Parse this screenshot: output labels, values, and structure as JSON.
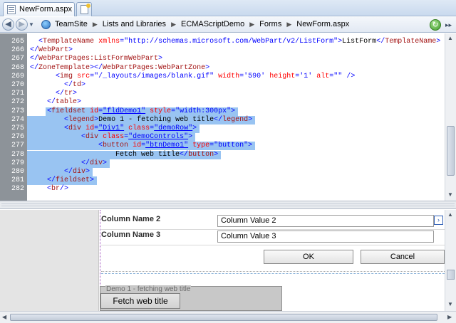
{
  "tab": {
    "title": "NewForm.aspx"
  },
  "breadcrumbs": [
    "TeamSite",
    "Lists and Libraries",
    "ECMAScriptDemo",
    "Forms",
    "NewForm.aspx"
  ],
  "code_lines": [
    {
      "num": "265",
      "html": "  <span class='p'>&lt;</span><span class='t'>TemplateName</span> <span class='a'>xmlns</span><span class='p'>=</span><span class='v'>\"http://schemas.microsoft.com/WebPart/v2/ListForm\"</span><span class='p'>&gt;</span>ListForm<span class='p'>&lt;/</span><span class='t'>TemplateName</span><span class='p'>&gt;</span>"
    },
    {
      "num": "266",
      "html": "<span class='p'>&lt;/</span><span class='t'>WebPart</span><span class='p'>&gt;</span>"
    },
    {
      "num": "267",
      "html": "<span class='p'>&lt;/</span><span class='t'>WebPartPages:ListFormWebPart</span><span class='p'>&gt;</span>"
    },
    {
      "num": "268",
      "html": "<span class='p'>&lt;/</span><span class='t'>ZoneTemplate</span><span class='p'>&gt;&lt;/</span><span class='t'>WebPartPages:WebPartZone</span><span class='p'>&gt;</span>"
    },
    {
      "num": "269",
      "html": "      <span class='p'>&lt;</span><span class='t'>img</span> <span class='a'>src</span><span class='p'>=</span><span class='v'>\"/_layouts/images/blank.gif\"</span> <span class='a'>width</span><span class='p'>=</span><span class='v'>'590'</span> <span class='a'>height</span><span class='p'>=</span><span class='v'>'1'</span> <span class='a'>alt</span><span class='p'>=</span><span class='v'>\"\"</span> <span class='p'>/&gt;</span>"
    },
    {
      "num": "270",
      "html": "        <span class='p'>&lt;/</span><span class='t'>td</span><span class='p'>&gt;</span>"
    },
    {
      "num": "271",
      "html": "      <span class='p'>&lt;/</span><span class='t'>tr</span><span class='p'>&gt;</span>"
    },
    {
      "num": "272",
      "html": "    <span class='p'>&lt;/</span><span class='t'>table</span><span class='p'>&gt;</span>"
    },
    {
      "num": "273",
      "html": "    <span class='p'>&lt;</span><span class='t'>fieldset</span> <span class='a'>id</span><span class='p'>=</span><span class='u'>\"fldDemo1\"</span> <span class='a'>style</span><span class='p'>=</span><span class='v'>\"width:300px\"</span><span class='p'>&gt;</span>"
    },
    {
      "num": "274",
      "html": "        <span class='p'>&lt;</span><span class='t'>legend</span><span class='p'>&gt;</span>Demo 1 - fetching web title<span class='p'>&lt;/</span><span class='t'>legend</span><span class='p'>&gt;</span>"
    },
    {
      "num": "275",
      "html": "        <span class='p'>&lt;</span><span class='t'>div</span> <span class='a'>id</span><span class='p'>=</span><span class='u'>\"Div1\"</span> <span class='a'>class</span><span class='p'>=</span><span class='u'>\"demoRow\"</span><span class='p'>&gt;</span>"
    },
    {
      "num": "276",
      "html": "            <span class='p'>&lt;</span><span class='t'>div</span> <span class='a'>class</span><span class='p'>=</span><span class='u'>\"demoControls\"</span><span class='p'>&gt;</span>"
    },
    {
      "num": "277",
      "html": "                <span class='p'>&lt;</span><span class='t'>button</span> <span class='a'>id</span><span class='p'>=</span><span class='u'>\"btnDemo1\"</span> <span class='a'>type</span><span class='p'>=</span><span class='v'>\"button\"</span><span class='p'>&gt;</span>"
    },
    {
      "num": "278",
      "html": "                    Fetch web title<span class='p'>&lt;/</span><span class='t'>button</span><span class='p'>&gt;</span>"
    },
    {
      "num": "279",
      "html": "            <span class='p'>&lt;/</span><span class='t'>div</span><span class='p'>&gt;</span>"
    },
    {
      "num": "280",
      "html": "        <span class='p'>&lt;/</span><span class='t'>div</span><span class='p'>&gt;</span>"
    },
    {
      "num": "281",
      "html": "    <span class='p'>&lt;/</span><span class='t'>fieldset</span><span class='p'>&gt;</span>"
    },
    {
      "num": "282",
      "html": "    <span class='p'>&lt;</span><span class='t'>br</span><span class='p'>/&gt;</span>"
    }
  ],
  "selected_lines": [
    "273",
    "274",
    "275",
    "276",
    "277",
    "278",
    "279",
    "280",
    "281"
  ],
  "design": {
    "rows": [
      {
        "label": "Column Name 2",
        "value": "Column Value 2"
      },
      {
        "label": "Column Name 3",
        "value": "Column Value 3"
      }
    ],
    "ok_label": "OK",
    "cancel_label": "Cancel",
    "fieldset_legend": "Demo 1 - fetching web title",
    "fetch_button": "Fetch web title"
  },
  "colors": {
    "selection": "#99c4f2",
    "gutter": "#8d9399",
    "tag": "#a31515",
    "attr": "#ff0000",
    "value": "#0000ff"
  },
  "icons": [
    "file-icon",
    "new-tab-icon",
    "back-icon",
    "forward-icon",
    "site-icon",
    "refresh-icon",
    "ellipsis-icon"
  ]
}
